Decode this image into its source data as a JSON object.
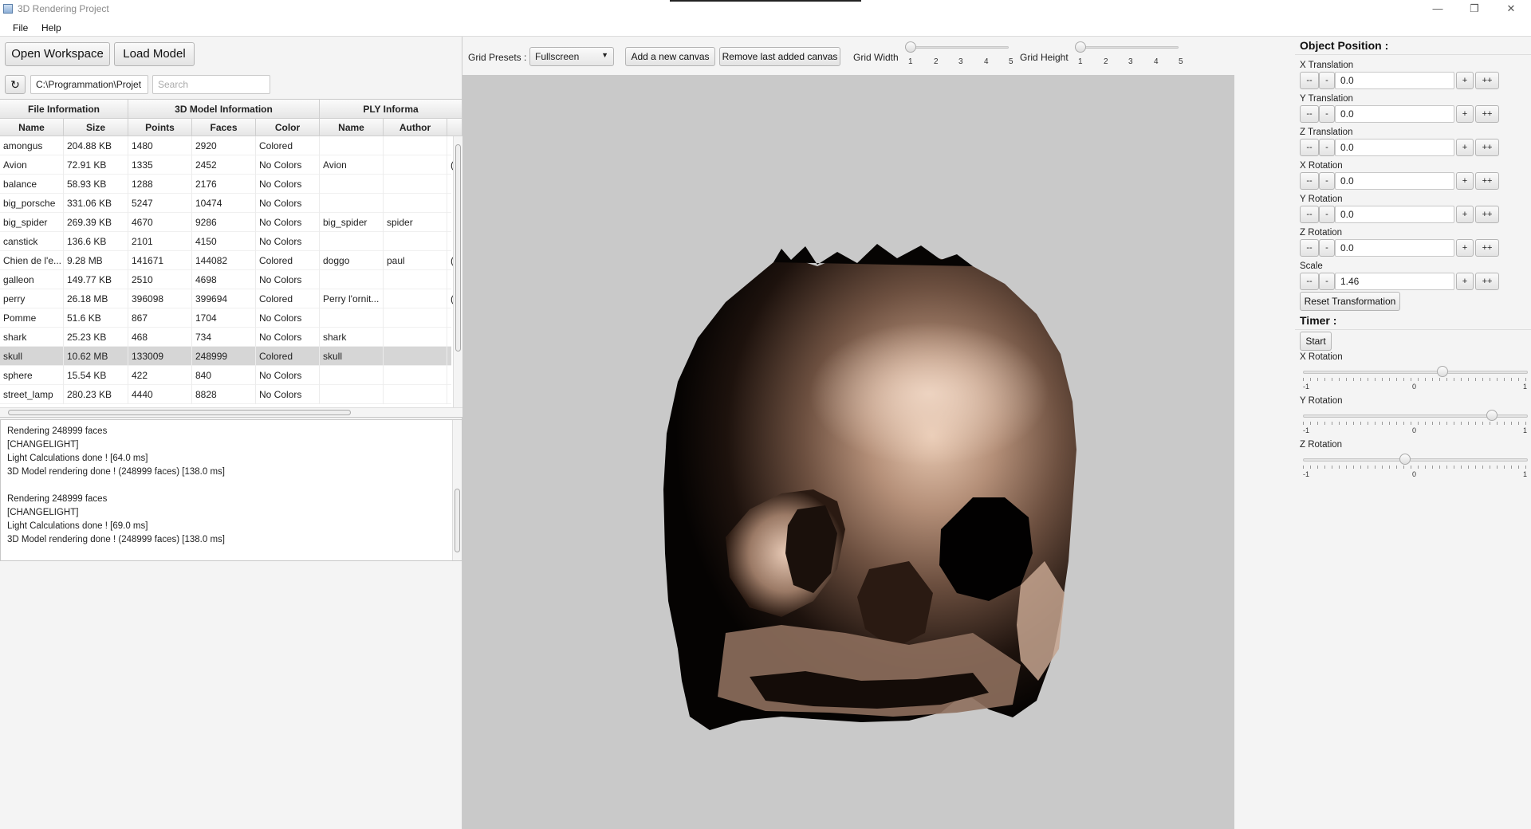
{
  "window": {
    "title": "3D Rendering Project",
    "controls": [
      "—",
      "❐",
      "✕"
    ]
  },
  "menu": [
    "File",
    "Help"
  ],
  "left": {
    "open_workspace": "Open Workspace",
    "load_model": "Load Model",
    "refresh_icon": "↻",
    "path": "C:\\Programmation\\Projet",
    "search_placeholder": "Search",
    "groups": [
      "File Information",
      "3D Model Information",
      "PLY Informa"
    ],
    "columns": [
      "Name",
      "Size",
      "Points",
      "Faces",
      "Color",
      "Name",
      "Author"
    ],
    "rows": [
      [
        "amongus",
        "204.88 KB",
        "1480",
        "2920",
        "Colored",
        "",
        "",
        ""
      ],
      [
        "Avion",
        "72.91 KB",
        "1335",
        "2452",
        "No Colors",
        "Avion",
        "",
        "("
      ],
      [
        "balance",
        "58.93 KB",
        "1288",
        "2176",
        "No Colors",
        "",
        "",
        ""
      ],
      [
        "big_porsche",
        "331.06 KB",
        "5247",
        "10474",
        "No Colors",
        "",
        "",
        ""
      ],
      [
        "big_spider",
        "269.39 KB",
        "4670",
        "9286",
        "No Colors",
        "big_spider",
        "spider",
        ""
      ],
      [
        "canstick",
        "136.6 KB",
        "2101",
        "4150",
        "No Colors",
        "",
        "",
        ""
      ],
      [
        "Chien de l'e...",
        "9.28 MB",
        "141671",
        "144082",
        "Colored",
        "doggo",
        "paul",
        "("
      ],
      [
        "galleon",
        "149.77 KB",
        "2510",
        "4698",
        "No Colors",
        "",
        "",
        ""
      ],
      [
        "perry",
        "26.18 MB",
        "396098",
        "399694",
        "Colored",
        "Perry l'ornit...",
        "",
        "("
      ],
      [
        "Pomme",
        "51.6 KB",
        "867",
        "1704",
        "No Colors",
        "",
        "",
        ""
      ],
      [
        "shark",
        "25.23 KB",
        "468",
        "734",
        "No Colors",
        "shark",
        "",
        ""
      ],
      [
        "skull",
        "10.62 MB",
        "133009",
        "248999",
        "Colored",
        "skull",
        "",
        ""
      ],
      [
        "sphere",
        "15.54 KB",
        "422",
        "840",
        "No Colors",
        "",
        "",
        ""
      ],
      [
        "street_lamp",
        "280.23 KB",
        "4440",
        "8828",
        "No Colors",
        "",
        "",
        ""
      ]
    ],
    "selected_row": 11,
    "log": [
      "Rendering 248999 faces",
      "[CHANGELIGHT]",
      "Light Calculations done ! [64.0 ms]",
      "3D Model rendering done ! (248999 faces) [138.0 ms]",
      "",
      "Rendering 248999 faces",
      "[CHANGELIGHT]",
      "Light Calculations done ! [69.0 ms]",
      "3D Model rendering done ! (248999 faces) [138.0 ms]"
    ]
  },
  "toolbar": {
    "grid_presets_label": "Grid Presets :",
    "grid_presets_value": "Fullscreen",
    "add_canvas": "Add a new canvas",
    "remove_canvas": "Remove last added canvas",
    "grid_width_label": "Grid Width",
    "grid_height_label": "Grid Height",
    "ticks": [
      "1",
      "2",
      "3",
      "4",
      "5"
    ],
    "grid_width_value": 1,
    "grid_height_value": 1
  },
  "right": {
    "object_position": "Object Position :",
    "controls": [
      {
        "label": "X Translation",
        "value": "0.0"
      },
      {
        "label": "Y Translation",
        "value": "0.0"
      },
      {
        "label": "Z Translation",
        "value": "0.0"
      },
      {
        "label": "X Rotation",
        "value": "0.0"
      },
      {
        "label": "Y Rotation",
        "value": "0.0"
      },
      {
        "label": "Z Rotation",
        "value": "0.0"
      },
      {
        "label": "Scale",
        "value": "1.46"
      }
    ],
    "btn_dec2": "--",
    "btn_dec": "-",
    "btn_inc": "+",
    "btn_inc2": "++",
    "reset": "Reset Transformation",
    "timer": "Timer :",
    "start": "Start",
    "timer_sliders": [
      {
        "label": "X Rotation",
        "value": 0.25
      },
      {
        "label": "Y Rotation",
        "value": 0.72
      },
      {
        "label": "Z Rotation",
        "value": -0.1
      }
    ],
    "tick_min": "-1",
    "tick_mid": "0",
    "tick_max": "1"
  }
}
